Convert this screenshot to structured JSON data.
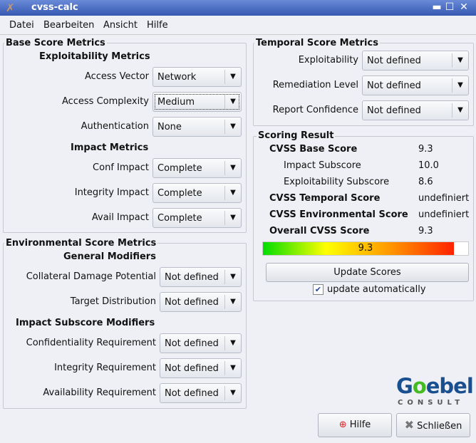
{
  "window": {
    "title": "cvss-calc"
  },
  "menu": [
    {
      "label": "Datei"
    },
    {
      "label": "Bearbeiten"
    },
    {
      "label": "Ansicht"
    },
    {
      "label": "Hilfe"
    }
  ],
  "base": {
    "title": "Base Score Metrics",
    "exploit_heading": "Exploitability Metrics",
    "impact_heading": "Impact Metrics",
    "rows": [
      {
        "label": "Access Vector",
        "value": "Network"
      },
      {
        "label": "Access Complexity",
        "value": "Medium"
      },
      {
        "label": "Authentication",
        "value": "None"
      },
      {
        "label": "Conf Impact",
        "value": "Complete"
      },
      {
        "label": "Integrity Impact",
        "value": "Complete"
      },
      {
        "label": "Avail Impact",
        "value": "Complete"
      }
    ]
  },
  "env": {
    "title": "Environmental Score Metrics",
    "general_heading": "General Modifiers",
    "impact_heading": "Impact Subscore Modifiers",
    "rows": [
      {
        "label": "Collateral Damage Potential",
        "value": "Not defined"
      },
      {
        "label": "Target Distribution",
        "value": "Not defined"
      },
      {
        "label": "Confidentiality Requirement",
        "value": "Not defined"
      },
      {
        "label": "Integrity Requirement",
        "value": "Not defined"
      },
      {
        "label": "Availability Requirement",
        "value": "Not defined"
      }
    ]
  },
  "temporal": {
    "title": "Temporal Score Metrics",
    "rows": [
      {
        "label": "Exploitability",
        "value": "Not defined"
      },
      {
        "label": "Remediation Level",
        "value": "Not defined"
      },
      {
        "label": "Report Confidence",
        "value": "Not defined"
      }
    ]
  },
  "scoring": {
    "title": "Scoring Result",
    "rows": [
      {
        "label": "CVSS Base Score",
        "value": "9.3"
      },
      {
        "label": "Impact Subscore",
        "value": "10.0"
      },
      {
        "label": "Exploitability Subscore",
        "value": "8.6"
      },
      {
        "label": "CVSS Temporal Score",
        "value": "undefiniert"
      },
      {
        "label": "CVSS Environmental Score",
        "value": "undefiniert"
      },
      {
        "label": "Overall CVSS Score",
        "value": "9.3"
      }
    ],
    "bar_label": "9.3",
    "bar_percent": 93,
    "update_button": "Update Scores",
    "auto_label": "update automatically",
    "auto_checked": true
  },
  "logo": {
    "text": "Goebel",
    "sub": "CONSULT"
  },
  "buttons": {
    "help": "Hilfe",
    "close": "Schließen"
  }
}
